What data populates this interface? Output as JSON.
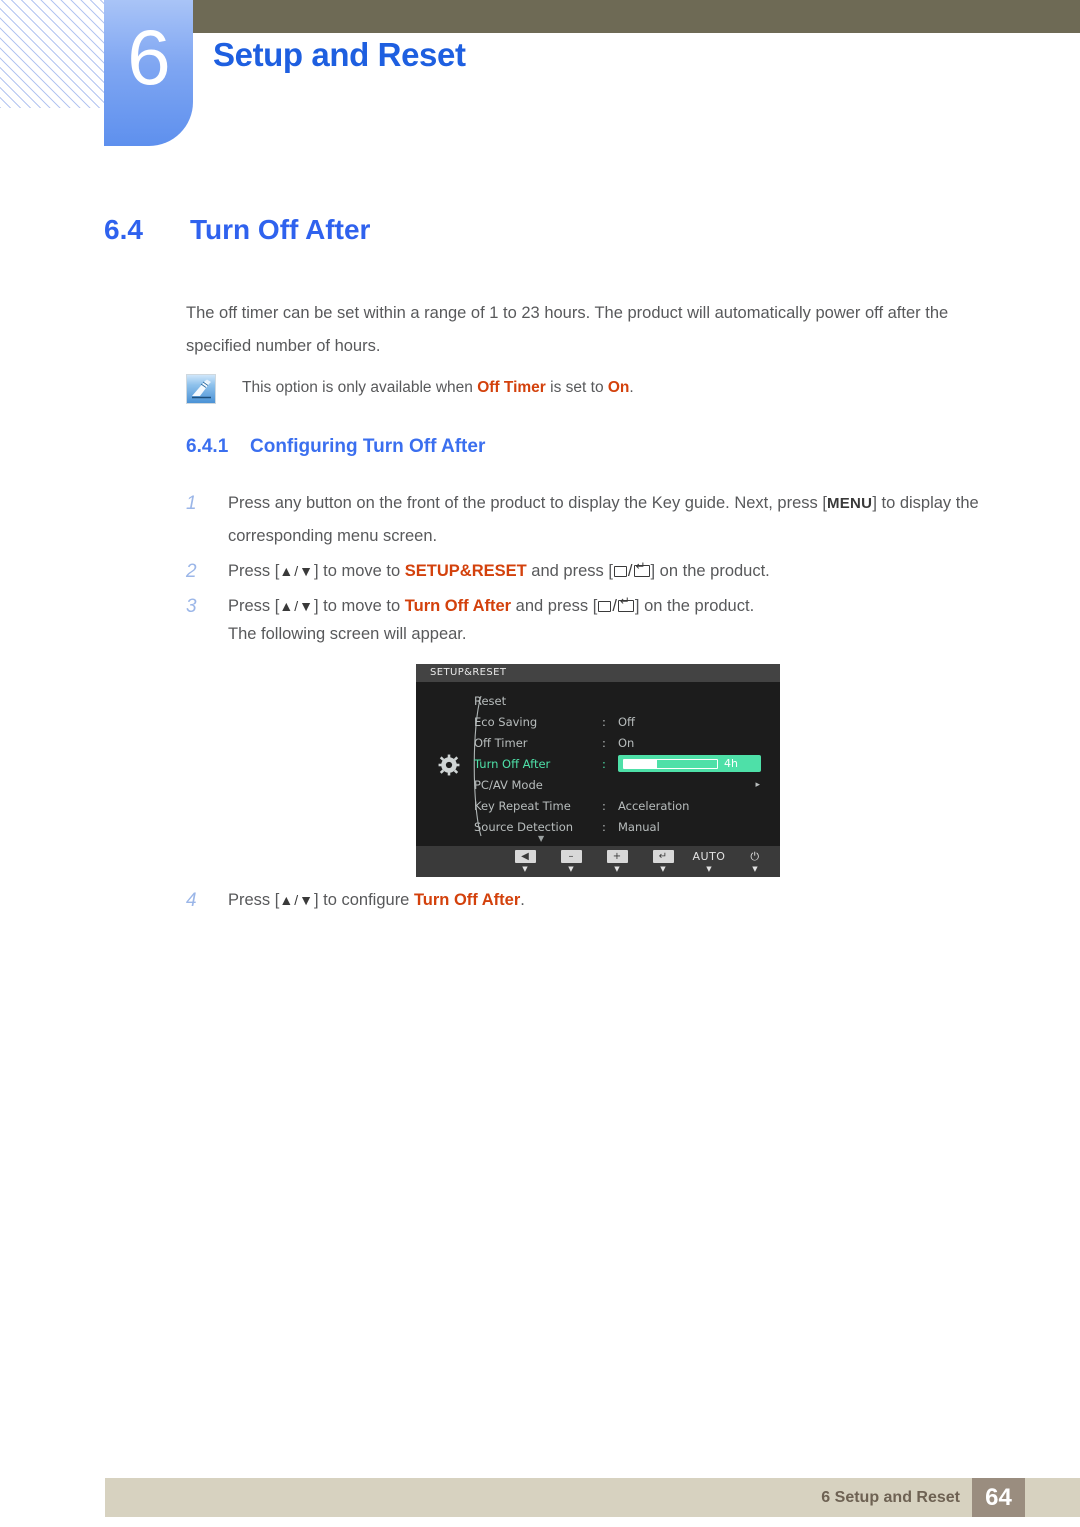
{
  "header": {
    "chapter_number": "6",
    "chapter_title": "Setup and Reset"
  },
  "section": {
    "number": "6.4",
    "title": "Turn Off After"
  },
  "intro": "The off timer can be set within a range of 1 to 23 hours. The product will automatically power off after the specified number of hours.",
  "note": {
    "icon": "note-pen-icon",
    "prefix": "This option is only available when ",
    "term1": "Off Timer",
    "middle": " is set to ",
    "term2": "On",
    "suffix": "."
  },
  "subsection": {
    "number": "6.4.1",
    "title": "Configuring Turn Off After"
  },
  "steps": [
    {
      "number": "1",
      "part1": "Press any button on the front of the product to display the Key guide. Next, press [",
      "keycap": "MENU",
      "part2": "] to display the corresponding menu screen."
    },
    {
      "number": "2",
      "part1": "Press [",
      "arrows": "▲/▼",
      "part2": "] to move to ",
      "target": "SETUP&RESET",
      "part3": " and press [",
      "part4": "] on the product."
    },
    {
      "number": "3",
      "part1": "Press [",
      "arrows": "▲/▼",
      "part2": "] to move to ",
      "target": "Turn Off After",
      "part3": " and press [",
      "part4": "] on the product."
    }
  ],
  "following_screen": "The following screen will appear.",
  "step4": {
    "number": "4",
    "part1": "Press [",
    "arrows": "▲/▼",
    "part2": "] to configure ",
    "target": "Turn Off After",
    "part3": "."
  },
  "osd": {
    "title": "SETUP&RESET",
    "selected_color": "#4ee0a8",
    "rows": [
      {
        "label": "Reset",
        "colon": "",
        "value": "",
        "selected": false,
        "type": "plain"
      },
      {
        "label": "Eco Saving",
        "colon": ":",
        "value": "Off",
        "selected": false,
        "type": "plain"
      },
      {
        "label": "Off Timer",
        "colon": ":",
        "value": "On",
        "selected": false,
        "type": "plain"
      },
      {
        "label": "Turn Off After",
        "colon": ":",
        "value": "4h",
        "selected": true,
        "type": "slider",
        "slider_percent": 35
      },
      {
        "label": "PC/AV Mode",
        "colon": "",
        "value": "",
        "selected": false,
        "type": "submenu",
        "arrow": "▸"
      },
      {
        "label": "Key Repeat Time",
        "colon": ":",
        "value": "Acceleration",
        "selected": false,
        "type": "plain"
      },
      {
        "label": "Source Detection",
        "colon": ":",
        "value": "Manual",
        "selected": false,
        "type": "plain"
      }
    ],
    "scroll_down": "▼",
    "buttons": [
      {
        "name": "back",
        "glyph": "◀",
        "bare": false,
        "chev": "▼"
      },
      {
        "name": "minus",
        "glyph": "–",
        "bare": false,
        "chev": "▼"
      },
      {
        "name": "plus",
        "glyph": "+",
        "bare": false,
        "chev": "▼"
      },
      {
        "name": "enter",
        "glyph": "↵",
        "bare": false,
        "chev": "▼"
      },
      {
        "name": "auto",
        "glyph": "AUTO",
        "bare": true,
        "chev": "▼"
      },
      {
        "name": "power",
        "glyph": "⏻",
        "bare": true,
        "chev": "▼"
      }
    ]
  },
  "footer": {
    "text": "6 Setup and Reset",
    "page": "64"
  },
  "colors": {
    "heading_blue": "#2f62ee",
    "highlight_red": "#d3410c",
    "header_olive": "#6e6a55",
    "footer_tan": "#d7d2c0",
    "footer_page_brown": "#9a8d7f"
  }
}
